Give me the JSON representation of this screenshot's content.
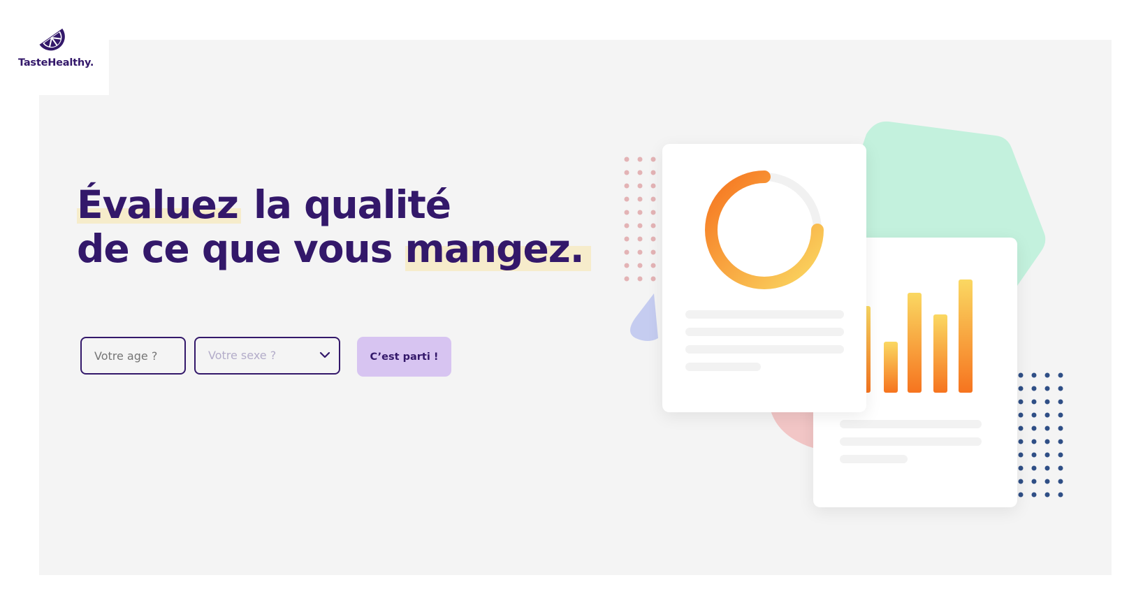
{
  "brand": {
    "name": "TasteHealthy.",
    "icon": "lemon-slice-icon"
  },
  "hero": {
    "title_line1_highlight": "Évaluez",
    "title_line1_rest": " la qualité",
    "title_line2_rest": "de ce que vous ",
    "title_line2_highlight": "mangez."
  },
  "form": {
    "age_placeholder": "Votre age ?",
    "sex_placeholder": "Votre sexe ?",
    "submit_label": "C’est parti !"
  },
  "illustration": {
    "donut_icon": "donut-chart-icon",
    "bar_chart_icon": "bar-chart-icon"
  },
  "colors": {
    "brand_purple": "#33186a",
    "highlight": "#f6eccb",
    "button": "#d7c4f1",
    "orange": "#f6741f",
    "yellow": "#fad862",
    "mint": "#c3f1dd",
    "pink": "#f2c6c6",
    "lavender": "#c5ccf0",
    "dot_navy": "#2f4f86",
    "dot_pink": "#e3b3b5"
  }
}
